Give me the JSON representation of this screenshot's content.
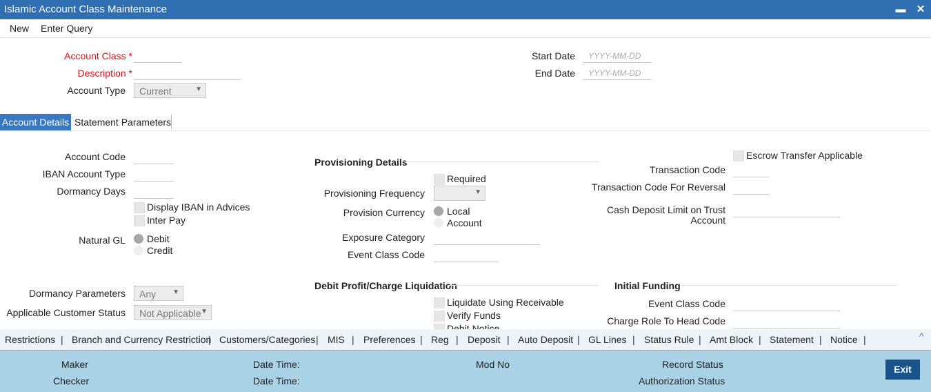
{
  "window": {
    "title": "Islamic Account Class Maintenance",
    "minimize": "▬",
    "close": "✕"
  },
  "menu": {
    "new": "New",
    "enter_query": "Enter Query"
  },
  "header": {
    "account_class": "Account Class",
    "description": "Description",
    "required_mark": "*",
    "account_type": "Account Type",
    "account_type_value": "Current",
    "start_date": "Start Date",
    "end_date": "End Date",
    "date_placeholder": "YYYY-MM-DD"
  },
  "tabs": {
    "account_details": "Account Details",
    "statement_parameters": "Statement Parameters"
  },
  "left": {
    "account_code": "Account Code",
    "iban_account_type": "IBAN Account Type",
    "dormancy_days": "Dormancy Days",
    "display_iban": "Display IBAN in Advices",
    "inter_pay": "Inter Pay",
    "natural_gl": "Natural GL",
    "debit": "Debit",
    "credit": "Credit",
    "dormancy_parameters": "Dormancy Parameters",
    "dormancy_parameters_value": "Any",
    "applicable_customer_status": "Applicable Customer Status",
    "applicable_customer_status_value": "Not Applicable"
  },
  "middle": {
    "provisioning_details": "Provisioning Details",
    "required": "Required",
    "provisioning_frequency": "Provisioning Frequency",
    "provision_currency": "Provision Currency",
    "local": "Local",
    "account": "Account",
    "exposure_category": "Exposure Category",
    "event_class_code": "Event Class Code",
    "debit_profit_liquidation": "Debit Profit/Charge Liquidation",
    "liquidate_using_receivable": "Liquidate Using Receivable",
    "verify_funds": "Verify Funds",
    "debit_notice": "Debit Notice"
  },
  "right": {
    "escrow_transfer": "Escrow Transfer Applicable",
    "transaction_code": "Transaction Code",
    "transaction_code_reversal": "Transaction Code For Reversal",
    "cash_deposit_limit_1": "Cash Deposit Limit on Trust",
    "cash_deposit_limit_2": "Account",
    "initial_funding": "Initial Funding",
    "event_class_code": "Event Class Code",
    "charge_role_to_head_code": "Charge Role To Head Code"
  },
  "links": [
    "Restrictions",
    "Branch and Currency Restriction",
    "Customers/Categories",
    "MIS",
    "Preferences",
    "Reg",
    "Deposit",
    "Auto Deposit",
    "GL Lines",
    "Status Rule",
    "Amt Block",
    "Statement",
    "Notice"
  ],
  "link_separator": "|",
  "collapse_icon": "^",
  "footer": {
    "maker": "Maker",
    "checker": "Checker",
    "date_time": "Date Time:",
    "mod_no": "Mod No",
    "record_status": "Record Status",
    "authorization_status": "Authorization Status",
    "exit": "Exit"
  }
}
